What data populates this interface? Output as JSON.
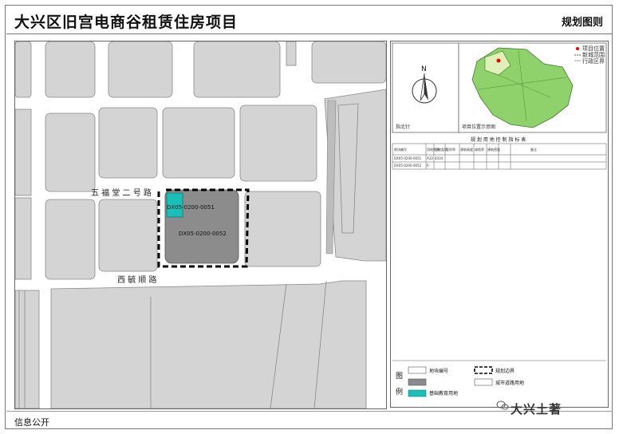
{
  "header": {
    "title": "大兴区旧宫电商谷租赁住房项目",
    "right_label": "规划图则"
  },
  "map": {
    "street_north_label": "五 福 堂 二 号 路",
    "street_south_label": "西 毓 顺 路",
    "parcel_small_label": "DX05-0200-0051",
    "parcel_main_label": "DX05-0200-0052",
    "colors": {
      "road": "#ffffff",
      "block": "#d4d4d4",
      "parcel": "#8c8c8c",
      "education": "#19c0b8",
      "boundary": "#000000"
    }
  },
  "side": {
    "north_label": "N",
    "compass_caption": "指北针",
    "location_caption": "项目位置示意图",
    "location_legend": [
      "项目位置",
      "新城范围",
      "行政区界"
    ],
    "table": {
      "title": "规 划 用 地 控 制 指 标 表",
      "headers": [
        "地块编号",
        "用地性质",
        "用地面积",
        "容积率",
        "建筑高度",
        "绿地率",
        "建筑密度",
        "备注"
      ],
      "rows": [
        [
          "DX05-0200-0051",
          "A33",
          "4334",
          "—",
          "—",
          "—",
          "—",
          "—"
        ],
        [
          "DX05-0200-0052",
          "R",
          "—",
          "—",
          "—",
          "—",
          "—",
          "—"
        ]
      ]
    },
    "legend_title_1": "图",
    "legend_title_2": "例",
    "legend_items": [
      {
        "label": "地块编号",
        "icon": "parcel-number-swatch"
      },
      {
        "label": "规划边界",
        "icon": "dashed-boundary-swatch"
      },
      {
        "label": "城市道路用地",
        "icon": "road-swatch"
      },
      {
        "label": "基础教育用地",
        "icon": "education-swatch"
      }
    ]
  },
  "footer": {
    "left": "信息公开"
  },
  "watermark": {
    "text": "大兴土著",
    "icon": "wechat-icon"
  }
}
